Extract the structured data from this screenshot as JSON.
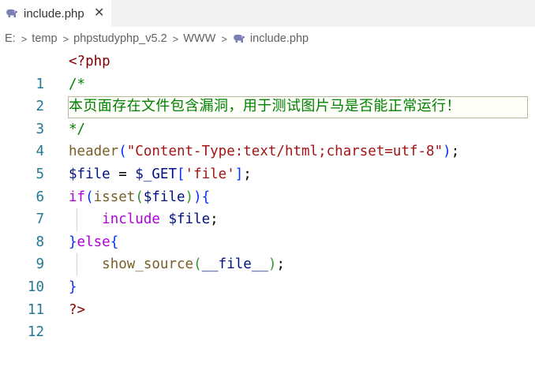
{
  "tab": {
    "label": "include.php",
    "close_glyph": "✕",
    "icon": "php-elephant-icon"
  },
  "breadcrumb": {
    "items": [
      "E:",
      "temp",
      "phpstudyphp_v5.2",
      "WWW",
      "include.php"
    ],
    "separator": ">"
  },
  "editor": {
    "line_numbers": [
      "1",
      "2",
      "3",
      "4",
      "5",
      "6",
      "7",
      "8",
      "9",
      "10",
      "11",
      "12"
    ],
    "lines": {
      "l1": {
        "open_tag": "<?php"
      },
      "l2": {
        "comment": "/*"
      },
      "l3": {
        "comment": "本页面存在文件包含漏洞，用于测试图片马是否能正常运行！"
      },
      "l4": {
        "comment": "*/"
      },
      "l5": {
        "fn": "header",
        "p_open": "(",
        "str": "\"Content-Type:text/html;charset=utf-8\"",
        "p_close": ")",
        "semi": ";"
      },
      "l6": {
        "var": "$file",
        "eq": " = ",
        "get": "$_GET",
        "b_open": "[",
        "key": "'file'",
        "b_close": "]",
        "semi": ";"
      },
      "l7": {
        "kw": "if",
        "p_open": "(",
        "fn": "isset",
        "p2_open": "(",
        "var": "$file",
        "p2_close": ")",
        "p_close": ")",
        "brace": "{"
      },
      "l8": {
        "kw": "include",
        "var": "$file",
        "semi": ";"
      },
      "l9": {
        "brace_close": "}",
        "kw": "else",
        "brace": "{"
      },
      "l10": {
        "fn": "show_source",
        "p_open": "(",
        "const": "__file__",
        "p_close": ")",
        "semi": ";"
      },
      "l11": {
        "brace_close": "}"
      },
      "l12": {
        "close_tag": "?>"
      }
    }
  },
  "colors": {
    "line_number": "#237893",
    "php_tag": "#800000",
    "comment": "#008000",
    "function": "#795e26",
    "string": "#a31515",
    "variable": "#001080",
    "keyword": "#af00db",
    "bracket_level1": "#0431fa",
    "bracket_level2": "#319331"
  }
}
